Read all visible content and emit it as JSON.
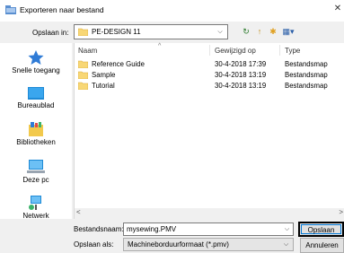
{
  "window": {
    "title": "Exporteren naar bestand",
    "close_glyph": "✕"
  },
  "location": {
    "label": "Opslaan in:",
    "value": "PE-DESIGN 11",
    "arrow": "⌵",
    "tools": {
      "back": "↻",
      "up": "↑",
      "new_folder": "✱",
      "view": "▦▾"
    }
  },
  "places": [
    {
      "label": "Snelle toegang",
      "icon": "star-icon"
    },
    {
      "label": "Bureaublad",
      "icon": "desktop-icon"
    },
    {
      "label": "Bibliotheken",
      "icon": "libraries-icon"
    },
    {
      "label": "Deze pc",
      "icon": "computer-icon"
    },
    {
      "label": "Netwerk",
      "icon": "network-icon"
    }
  ],
  "columns": {
    "name": "Naam",
    "modified": "Gewijzigd op",
    "type": "Type",
    "sort_caret": "^"
  },
  "files": [
    {
      "name": "Reference Guide",
      "modified": "30-4-2018 17:39",
      "type": "Bestandsmap"
    },
    {
      "name": "Sample",
      "modified": "30-4-2018 13:19",
      "type": "Bestandsmap"
    },
    {
      "name": "Tutorial",
      "modified": "30-4-2018 13:19",
      "type": "Bestandsmap"
    }
  ],
  "scroll": {
    "left": "<",
    "right": ">"
  },
  "filename": {
    "label": "Bestandsnaam:",
    "value": "mysewing.PMV",
    "arrow": "⌵"
  },
  "filetype": {
    "label": "Opslaan als:",
    "value": "Machineborduurformaat (*.pmv)",
    "arrow": "⌵"
  },
  "buttons": {
    "save": "Opslaan",
    "cancel": "Annuleren"
  },
  "colors": {
    "folder": "#f8d775",
    "accent": "#0078d7"
  }
}
